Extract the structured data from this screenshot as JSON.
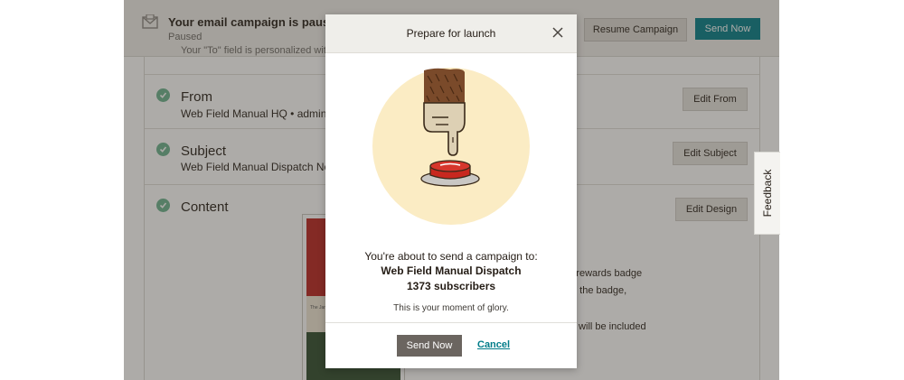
{
  "topbar": {
    "status_title": "Your email campaign is paused.",
    "status_sub": "Paused",
    "resume_label": "Resume Campaign",
    "send_now_label": "Send Now"
  },
  "checklist": {
    "cut_text": "Your \"To\" field is personalized with *|",
    "sections": [
      {
        "title": "From",
        "subtitle": "Web Field Manual HQ • admin@",
        "edit_label": "Edit From"
      },
      {
        "title": "Subject",
        "subtitle": "Web Field Manual Dispatch No.",
        "edit_label": "Edit Subject"
      },
      {
        "title": "Content",
        "subtitle": "",
        "edit_label": "Edit Design"
      }
    ],
    "content_notes": [
      "ed rewards badge",
      "e the badge,",
      "ail will be included"
    ],
    "thumb_text": "The Janua"
  },
  "feedback_label": "Feedback",
  "modal": {
    "title": "Prepare for launch",
    "line1": "You're about to send a campaign to:",
    "campaign_name": "Web Field Manual Dispatch",
    "subscribers": "1373 subscribers",
    "tagline": "This is your moment of glory.",
    "send_label": "Send Now",
    "cancel_label": "Cancel"
  },
  "colors": {
    "teal": "#007c89",
    "check_green": "#6ab18e",
    "illustration_bg": "#fbecc4",
    "button_red": "#d6362c"
  }
}
